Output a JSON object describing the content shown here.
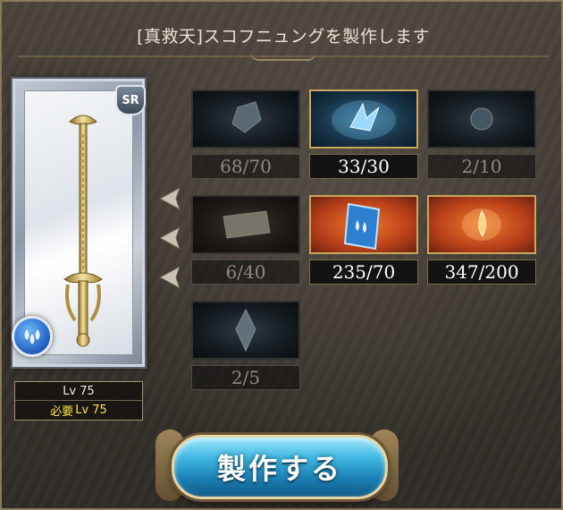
{
  "header": {
    "title": "[真救天]スコフニュングを製作します"
  },
  "weapon": {
    "rarity": "SR",
    "element_icon": "water-drops-icon",
    "level": "Lv 75",
    "required_label": "必要",
    "required_value": "Lv 75"
  },
  "materials": [
    {
      "name_icon": "blue-crystal-icon",
      "count": "68/70",
      "sufficient": false
    },
    {
      "name_icon": "glowing-crystal-shard-icon",
      "count": "33/30",
      "sufficient": true
    },
    {
      "name_icon": "blue-orb-icon",
      "count": "2/10",
      "sufficient": false
    },
    {
      "name_icon": "scroll-icon",
      "count": "6/40",
      "sufficient": false
    },
    {
      "name_icon": "blue-tome-icon",
      "count": "235/70",
      "sufficient": true
    },
    {
      "name_icon": "orange-flame-icon",
      "count": "347/200",
      "sufficient": true
    },
    {
      "name_icon": "blue-gem-icon",
      "count": "2/5",
      "sufficient": false
    }
  ],
  "craft_button": {
    "label": "製作する"
  },
  "colors": {
    "accent_gold": "#c8a85a",
    "required_yellow": "#ffe14a",
    "button_blue": "#3fb6e0"
  }
}
